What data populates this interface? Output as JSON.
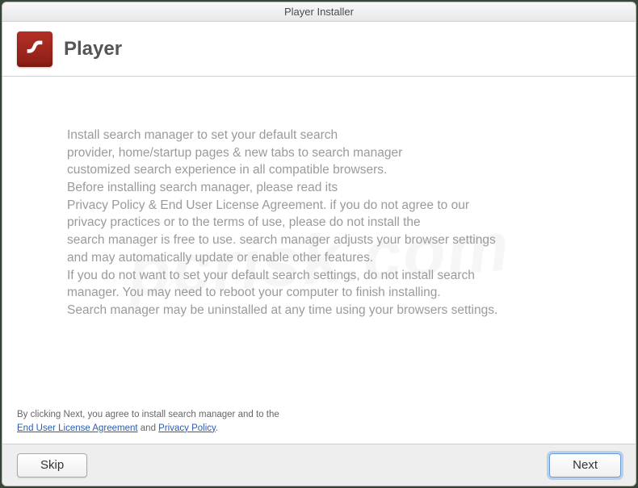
{
  "window": {
    "title": "Player Installer"
  },
  "header": {
    "app_name": "Player",
    "icon_name": "flash-icon"
  },
  "body": {
    "text": "Install search manager to set your default search\nprovider, home/startup pages & new tabs to search manager\ncustomized search experience in all compatible browsers.\nBefore installing search manager, please read its\nPrivacy Policy & End User License Agreement. if you do not agree to our\nprivacy practices or to the terms of use, please do not install the\nsearch manager is free to use. search manager adjusts your browser settings\nand may automatically update or enable other features.\nIf you do not want to set your default search settings, do not install search\nmanager. You may need to reboot your computer to finish installing.\nSearch manager may be uninstalled at any time using your browsers settings."
  },
  "agreement": {
    "prefix": "By clicking Next, you agree to install search manager and to the",
    "eula": "End User License Agreement",
    "and": " and ",
    "privacy": "Privacy Policy",
    "suffix": "."
  },
  "footer": {
    "skip_label": "Skip",
    "next_label": "Next"
  },
  "watermark": "pcrisk.com"
}
